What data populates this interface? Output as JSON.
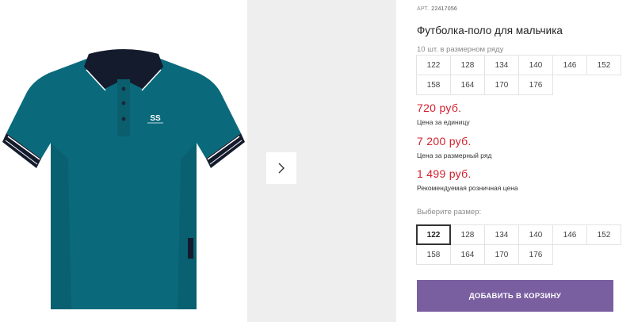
{
  "product": {
    "sku_label": "АРТ.",
    "sku_value": "22417056",
    "title": "Футболка-поло для мальчика",
    "pack_note": "10 шт. в размерном ряду",
    "pack_sizes": [
      "122",
      "128",
      "134",
      "140",
      "146",
      "152",
      "158",
      "164",
      "170",
      "176"
    ],
    "prices": [
      {
        "amount": "720 руб.",
        "note": "Цена за единицу"
      },
      {
        "amount": "7 200 руб.",
        "note": "Цена за размерный ряд"
      },
      {
        "amount": "1 499 руб.",
        "note": "Рекомендуемая розничная цена"
      }
    ],
    "choose_size_label": "Выберите размер:",
    "size_options": [
      "122",
      "128",
      "134",
      "140",
      "146",
      "152",
      "158",
      "164",
      "170",
      "176"
    ],
    "selected_size": "122",
    "add_to_cart_label": "ДОБАВИТЬ В КОРЗИНУ",
    "image_logo_text": "SS"
  },
  "colors": {
    "price_red": "#d3202e",
    "button_purple": "#7a5fa0",
    "shirt_teal": "#0a6a7c",
    "collar_navy": "#141b2c"
  },
  "icons": {
    "next_arrow": "chevron-right-icon"
  }
}
